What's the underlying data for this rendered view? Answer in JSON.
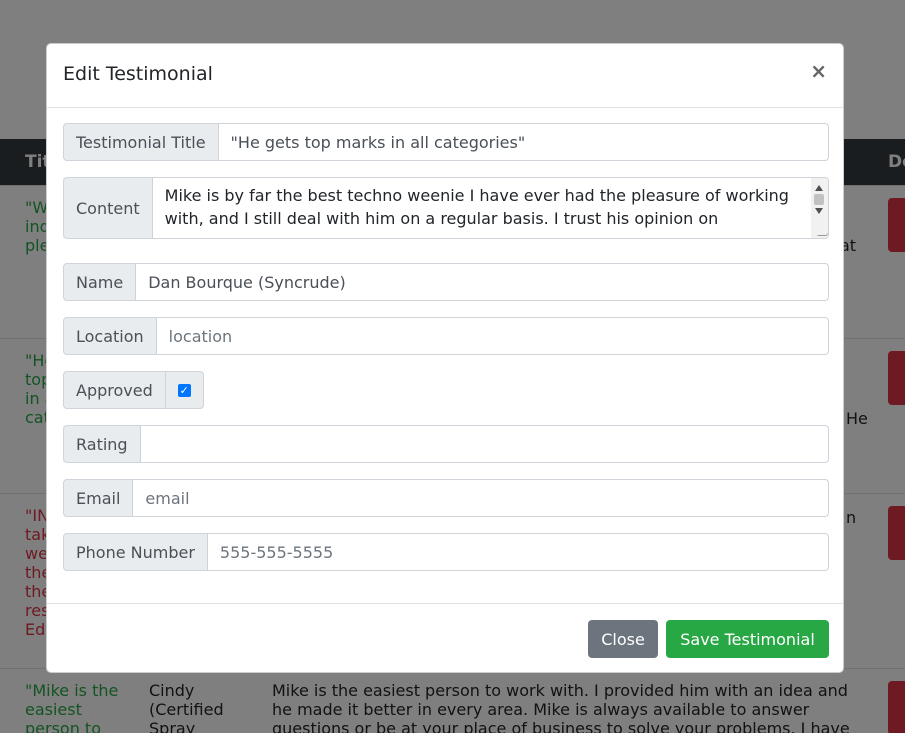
{
  "background": {
    "header": {
      "title_fragment": "Tit",
      "delete_fragment": "De"
    },
    "rows": [
      {
        "title_fragment": "\"W\nind\nple",
        "content_fragment": "at"
      },
      {
        "title_fragment": "\"He\ntop\nin a\ncat",
        "content_fragment": "He"
      },
      {
        "title_fragment": "\"IN\ntak\nwe\nthe\nthe\nres\nEd",
        "content_fragment": "n"
      },
      {
        "title": "\"Mike is the\neasiest\nperson to",
        "name": "Cindy\n(Certified\nSpray",
        "content": "Mike is the easiest person to work with. I provided him with an idea and\nhe made it better in every area. Mike is always available to answer\nquestions or be at your place of business to solve your problems. I have"
      }
    ]
  },
  "modal": {
    "title": "Edit Testimonial",
    "close_symbol": "×",
    "fields": {
      "testimonial_title": {
        "label": "Testimonial Title",
        "value": "\"He gets top marks in all categories\""
      },
      "content": {
        "label": "Content",
        "value": "Mike is by far the best techno weenie I have ever had the pleasure of working with, and I still deal with him on a regular basis. I trust his opinion on"
      },
      "name": {
        "label": "Name",
        "value": "Dan Bourque (Syncrude)"
      },
      "location": {
        "label": "Location",
        "value": "",
        "placeholder": "location"
      },
      "approved": {
        "label": "Approved",
        "checked": true
      },
      "rating": {
        "label": "Rating",
        "value": ""
      },
      "email": {
        "label": "Email",
        "value": "",
        "placeholder": "email"
      },
      "phone": {
        "label": "Phone Number",
        "value": "",
        "placeholder": "555-555-5555"
      }
    },
    "footer": {
      "close_label": "Close",
      "save_label": "Save Testimonial"
    }
  },
  "colors": {
    "save_button": "#28a745",
    "close_button": "#6c757d",
    "checkbox": "#0075ff",
    "title_green": "#28a745",
    "title_red": "#dc3545"
  }
}
